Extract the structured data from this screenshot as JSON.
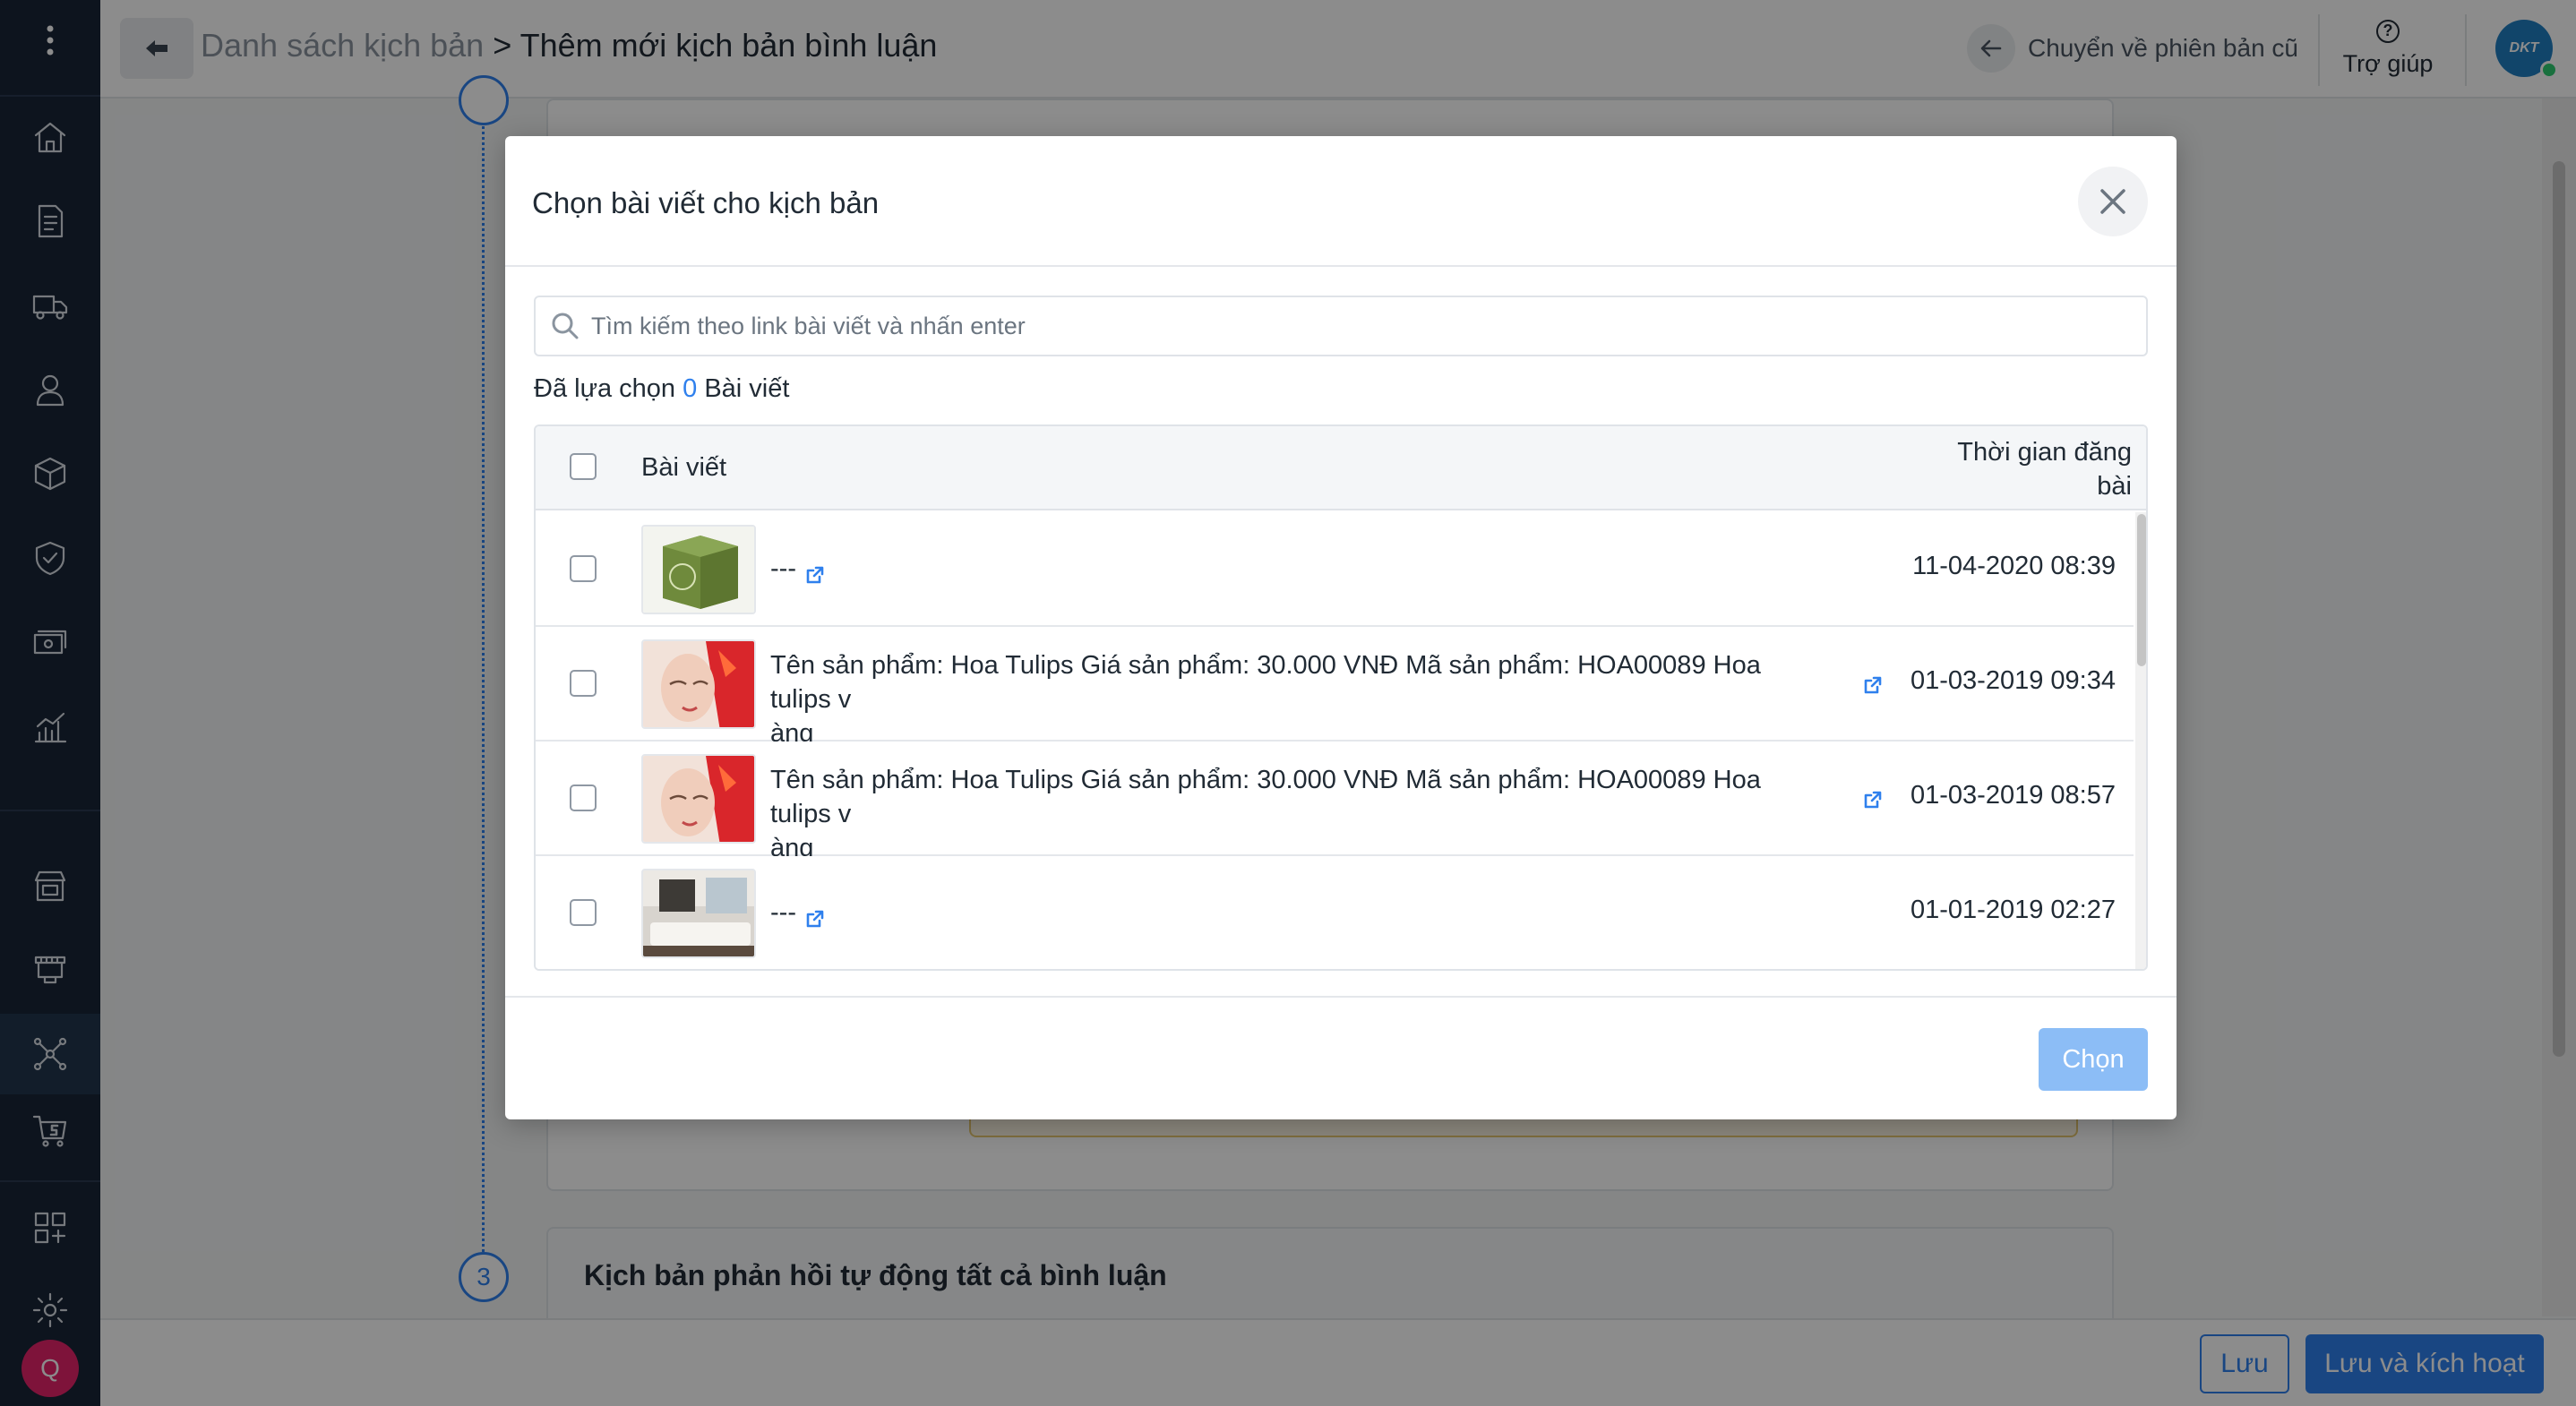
{
  "header": {
    "breadcrumb_parent": "Danh sách kịch bản",
    "breadcrumb_sep": " > ",
    "breadcrumb_current": "Thêm mới kịch bản bình luận",
    "old_version_label": "Chuyển về phiên bản cũ",
    "help_label": "Trợ giúp",
    "brand_logo_text": "DKT"
  },
  "sidebar": {
    "avatar_letter": "Q",
    "icons": [
      "menu-dots-icon",
      "home-icon",
      "orders-icon",
      "shipping-icon",
      "customer-icon",
      "product-icon",
      "warranty-icon",
      "cashbook-icon",
      "report-icon",
      "store-icon",
      "pos-icon",
      "omnichannel-icon",
      "shopee-icon",
      "apps-icon",
      "settings-icon"
    ]
  },
  "background": {
    "step3_number": "3",
    "step3_title": "Kịch bản phản hồi tự động tất cả bình luận"
  },
  "footer": {
    "save_label": "Lưu",
    "save_activate_label": "Lưu và kích hoạt"
  },
  "modal": {
    "title": "Chọn bài viết cho kịch bản",
    "search_placeholder": "Tìm kiếm theo link bài viết và nhấn enter",
    "selected_prefix": "Đã lựa chọn ",
    "selected_count": "0",
    "selected_suffix": " Bài viết",
    "col_post": "Bài viết",
    "col_time": "Thời gian đăng bài",
    "choose_label": "Chọn",
    "rows": [
      {
        "title": "---",
        "date": "11-04-2020 08:39",
        "thumb": "green-box"
      },
      {
        "title": "Tên sản phẩm: Hoa Tulips Giá sản phẩm: 30.000 VNĐ Mã sản phẩm: HOA00089 Hoa tulips v",
        "title_line2": "àng",
        "date": "01-03-2019 09:34",
        "thumb": "face-red"
      },
      {
        "title": "Tên sản phẩm: Hoa Tulips Giá sản phẩm: 30.000 VNĐ Mã sản phẩm: HOA00089 Hoa tulips v",
        "title_line2": "àng",
        "date": "01-03-2019 08:57",
        "thumb": "face-red"
      },
      {
        "title": "---",
        "date": "01-01-2019 02:27",
        "thumb": "living-room"
      }
    ]
  },
  "colors": {
    "accent": "#2f80ed",
    "sidebar": "#182537",
    "choose_disabled": "#8cbdf6"
  }
}
